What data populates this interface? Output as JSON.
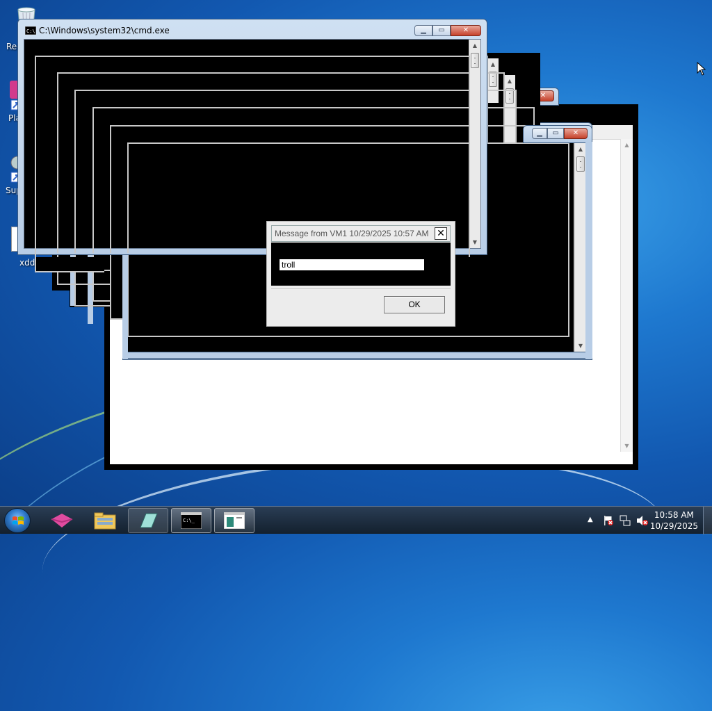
{
  "desktop": {
    "icons": [
      {
        "label": "Rec",
        "icon": "recycle-bin-icon"
      },
      {
        "label": "Pla",
        "icon": "player-shortcut-icon"
      },
      {
        "label": "Sup",
        "icon": "support-shortcut-icon"
      },
      {
        "label": "xdd",
        "icon": "document-icon"
      }
    ]
  },
  "cmd_window": {
    "title": "C:\\Windows\\system32\\cmd.exe",
    "icon": "cmd-icon",
    "buttons": {
      "minimize": "minimize-icon",
      "maximize": "maximize-icon",
      "close": "close-icon"
    }
  },
  "message_dialog": {
    "title": "Message from VM1 10/29/2025 10:57 AM",
    "close_label": "✕",
    "message": "troll",
    "ok_label": "OK"
  },
  "taskbar": {
    "start_icon": "windows-start-icon",
    "pinned": [
      {
        "name": "app-pink-icon"
      },
      {
        "name": "file-explorer-icon"
      },
      {
        "name": "glass-app-icon"
      },
      {
        "name": "cmd-taskbar-icon",
        "active": true
      },
      {
        "name": "notepad-taskbar-icon",
        "active": true
      }
    ],
    "tray_icons": [
      "show-hidden-icons-chevron",
      "action-center-flag-icon",
      "network-icon",
      "volume-muted-icon"
    ],
    "clock": {
      "time": "10:58 AM",
      "date": "10/29/2025"
    }
  },
  "colors": {
    "desktop_blue": "#1e78cf",
    "console_bg": "#000000",
    "close_red": "#c6412b"
  }
}
